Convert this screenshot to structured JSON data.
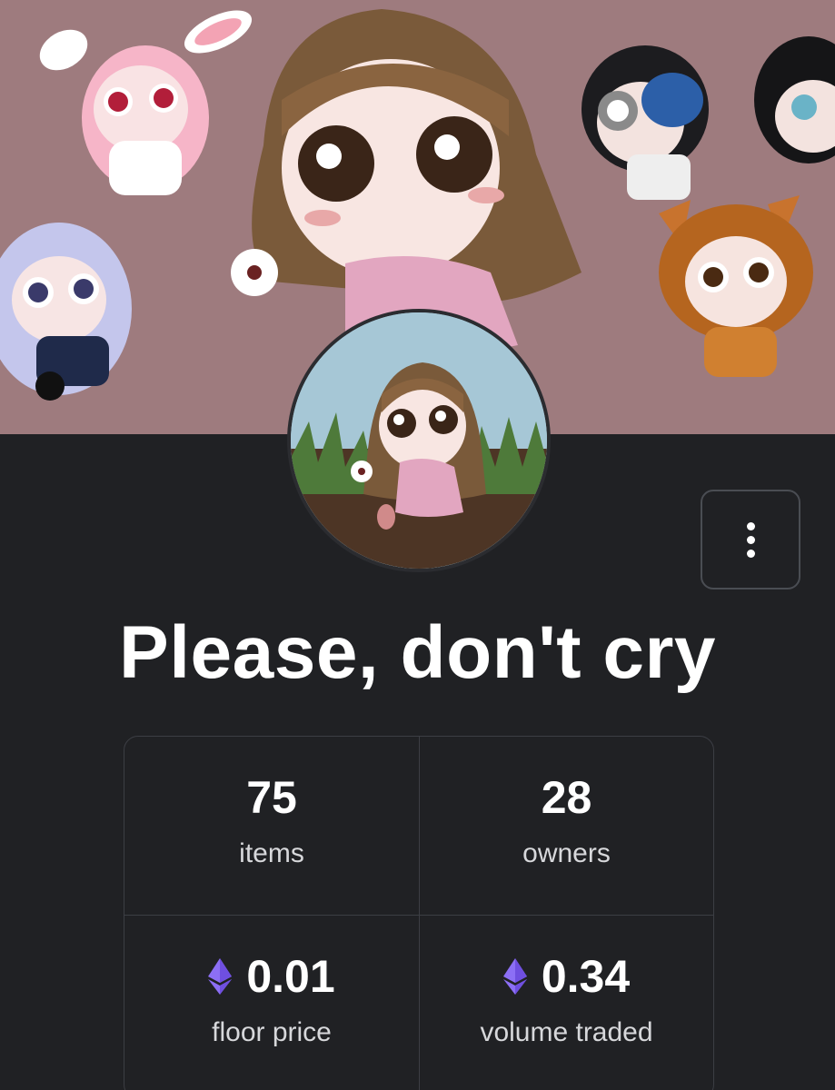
{
  "collection": {
    "name": "Please, don't cry",
    "banner_icon": "chibi-characters-banner",
    "avatar_icon": "chibi-girl-with-flower-avatar"
  },
  "menu_button": {
    "icon": "more-vertical-icon"
  },
  "stats": {
    "items": {
      "value": "75",
      "label": "items"
    },
    "owners": {
      "value": "28",
      "label": "owners"
    },
    "floor_price": {
      "value": "0.01",
      "label": "floor price",
      "currency_icon": "ethereum-icon"
    },
    "volume_traded": {
      "value": "0.34",
      "label": "volume traded",
      "currency_icon": "ethereum-icon"
    }
  },
  "colors": {
    "background": "#202124",
    "banner": "#9e7b7e",
    "eth_purple": "#8c6ff5",
    "border": "#3c3e44"
  }
}
